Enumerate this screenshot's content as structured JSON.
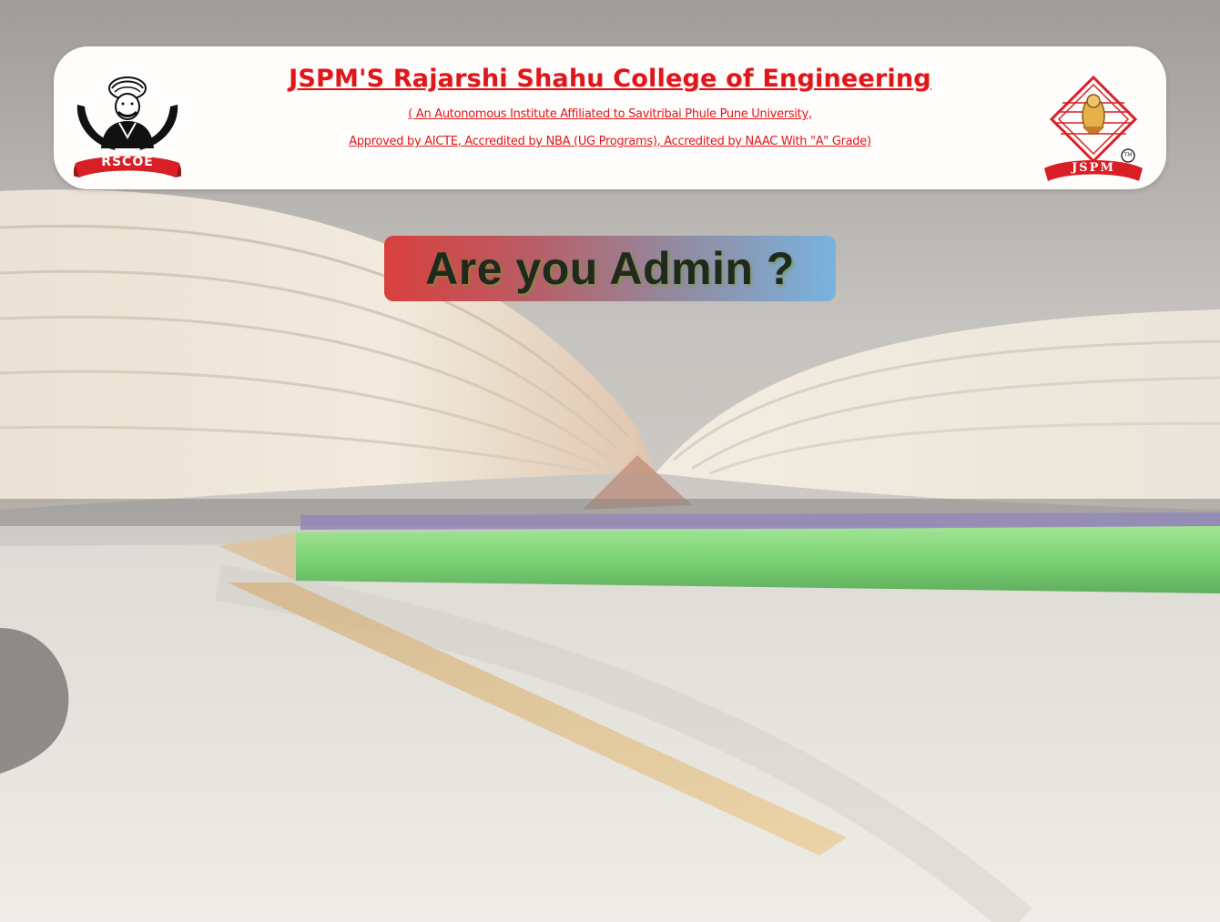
{
  "header": {
    "college_name": "JSPM'S Rajarshi Shahu College of Engineering",
    "tagline_line1": "( An Autonomous Institute Affiliated to Savitribai Phule Pune University,",
    "tagline_line2": "Approved by AICTE, Accredited by NBA (UG Programs), Accredited by NAAC With \"A\" Grade)",
    "logo_left_text": "RSCOE",
    "logo_right_text": "JSPM",
    "logo_right_mark": "TM"
  },
  "admin_prompt": {
    "label": "Are you Admin ?"
  },
  "colors": {
    "accent_red": "#e0161b",
    "banner_gradient_start": "#d9403d",
    "banner_gradient_end": "#78b3de",
    "header_bg": "#fffdfb"
  },
  "icons": {
    "logo_left": "rscoe-logo-icon",
    "logo_right": "jspm-logo-icon",
    "background": "open-book-pencil-image"
  }
}
